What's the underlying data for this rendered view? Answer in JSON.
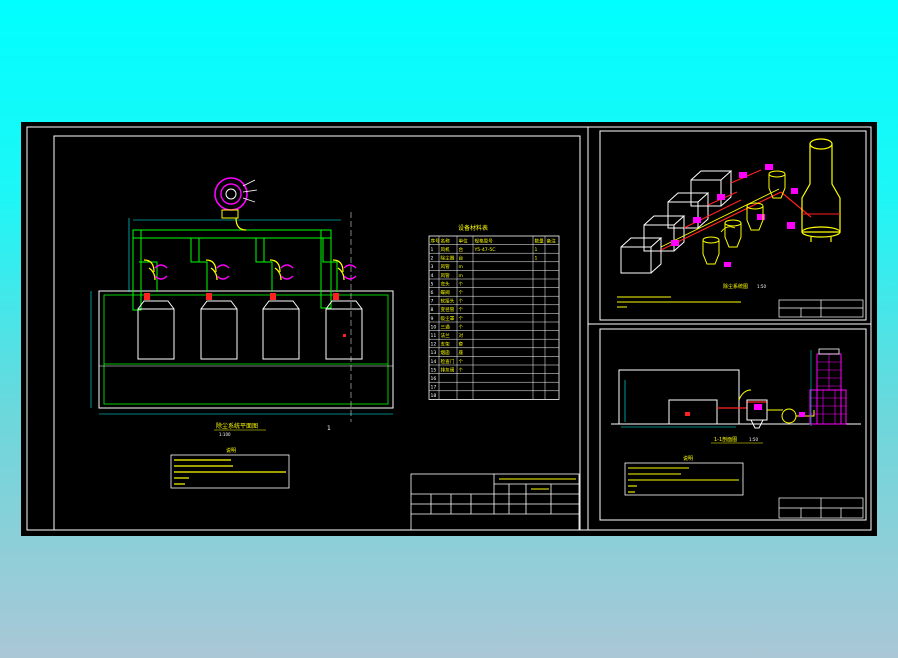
{
  "drawing": {
    "plan_title": "除尘系统平面图",
    "plan_scale": "1:100",
    "section_mark": "1",
    "iso_title": "除尘系统图",
    "iso_scale": "1:50",
    "section_title": "1-1剖面图",
    "section_scale": "1:50",
    "notes_title": "说明",
    "table_title": "设备材料表",
    "table_headers": [
      "序号",
      "名称",
      "单位",
      "规格型号",
      "数量",
      "备注"
    ],
    "table_rows": [
      [
        "1",
        "风机",
        "台",
        "Y5-47-5C",
        "1",
        ""
      ],
      [
        "2",
        "除尘器",
        "台",
        "",
        "1",
        ""
      ],
      [
        "3",
        "风管",
        "m",
        "",
        "",
        ""
      ],
      [
        "4",
        "风管",
        "m",
        "",
        "",
        ""
      ],
      [
        "5",
        "弯头",
        "个",
        "",
        "",
        ""
      ],
      [
        "6",
        "蝶阀",
        "个",
        "",
        "",
        ""
      ],
      [
        "7",
        "软接头",
        "个",
        "",
        "",
        ""
      ],
      [
        "8",
        "变径管",
        "个",
        "",
        "",
        ""
      ],
      [
        "9",
        "吸尘罩",
        "个",
        "",
        "",
        ""
      ],
      [
        "10",
        "三通",
        "个",
        "",
        "",
        ""
      ],
      [
        "11",
        "法兰",
        "对",
        "",
        "",
        ""
      ],
      [
        "12",
        "支架",
        "套",
        "",
        "",
        ""
      ],
      [
        "13",
        "烟囱",
        "座",
        "",
        "",
        ""
      ],
      [
        "14",
        "检查门",
        "个",
        "",
        "",
        ""
      ],
      [
        "15",
        "排灰阀",
        "个",
        "",
        "",
        ""
      ],
      [
        "16",
        "",
        "",
        "",
        "",
        ""
      ],
      [
        "17",
        "",
        "",
        "",
        "",
        ""
      ],
      [
        "18",
        "",
        "",
        "",
        "",
        ""
      ]
    ]
  },
  "colors": {
    "page_bg_top": "#00ffff",
    "page_bg_bottom": "#aac7d6",
    "sheet": "#000000",
    "frame": "#ffffff",
    "duct": "#00ff00",
    "dim": "#00ffff",
    "equipment": "#ffff00",
    "valve": "#ff00ff",
    "fitting": "#ff2020"
  }
}
